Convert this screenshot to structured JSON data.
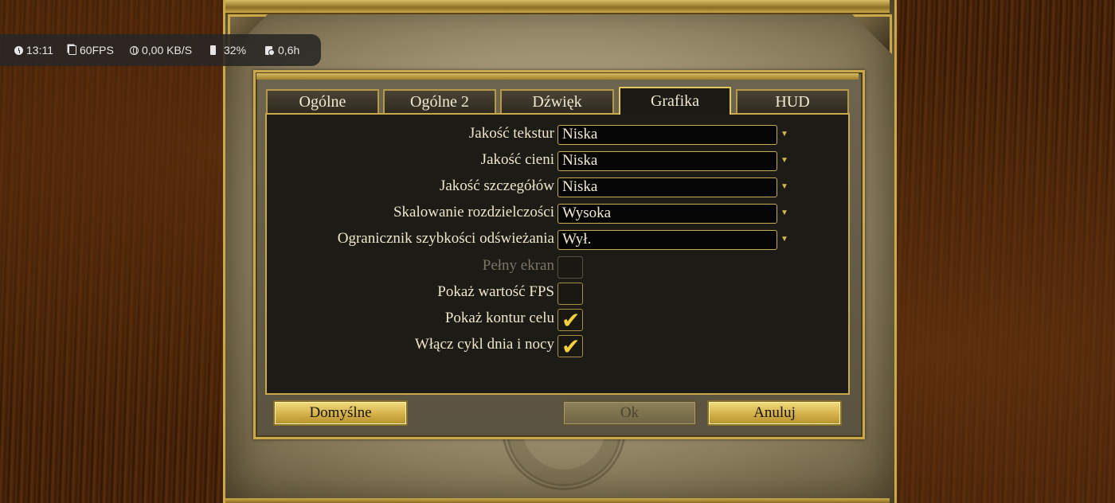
{
  "overlay": {
    "time": "13:11",
    "fps": "60FPS",
    "network": "0,00 KB/S",
    "battery": "32%",
    "playtime": "0,6h"
  },
  "tabs": [
    {
      "label": "Ogólne",
      "active": false
    },
    {
      "label": "Ogólne 2",
      "active": false
    },
    {
      "label": "Dźwięk",
      "active": false
    },
    {
      "label": "Grafika",
      "active": true
    },
    {
      "label": "HUD",
      "active": false
    }
  ],
  "settings": {
    "texture_quality": {
      "label": "Jakość tekstur",
      "value": "Niska"
    },
    "shadow_quality": {
      "label": "Jakość cieni",
      "value": "Niska"
    },
    "detail_quality": {
      "label": "Jakość szczegółów",
      "value": "Niska"
    },
    "resolution_scaling": {
      "label": "Skalowanie rozdzielczości",
      "value": "Wysoka"
    },
    "refresh_limiter": {
      "label": "Ogranicznik szybkości odświeżania",
      "value": "Wył."
    },
    "fullscreen": {
      "label": "Pełny ekran",
      "checked": false,
      "enabled": false
    },
    "show_fps": {
      "label": "Pokaż wartość FPS",
      "checked": false,
      "enabled": true
    },
    "show_outline": {
      "label": "Pokaż kontur celu",
      "checked": true,
      "enabled": true
    },
    "day_night": {
      "label": "Włącz cykl dnia i nocy",
      "checked": true,
      "enabled": true
    }
  },
  "buttons": {
    "defaults": "Domyślne",
    "ok": "Ok",
    "cancel": "Anuluj"
  },
  "check_glyph": "✔",
  "dropdown_glyph": "▼",
  "colors": {
    "accent_gold": "#c9a94a",
    "check_yellow": "#f4cf3e",
    "panel_dark": "#1d1b15"
  }
}
